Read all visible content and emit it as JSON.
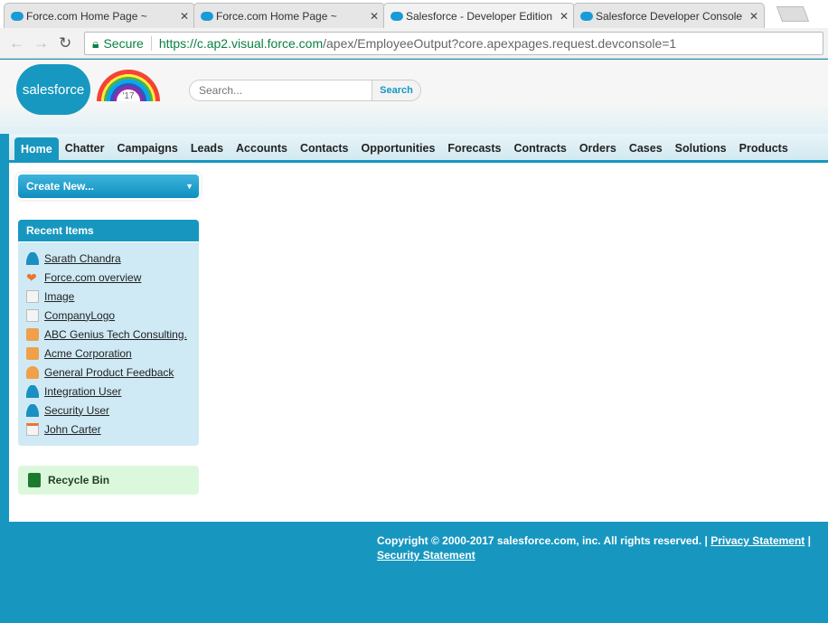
{
  "browser": {
    "tabs": [
      {
        "title": "Force.com Home Page ~"
      },
      {
        "title": "Force.com Home Page ~"
      },
      {
        "title": "Salesforce - Developer Edition"
      },
      {
        "title": "Salesforce Developer Console"
      }
    ],
    "secure_label": "Secure",
    "url_host": "https://c.ap2.visual.force.com",
    "url_path": "/apex/EmployeeOutput?core.apexpages.request.devconsole=1"
  },
  "header": {
    "logo": "salesforce",
    "badge": "'17",
    "search_placeholder": "Search...",
    "search_button": "Search"
  },
  "nav": {
    "tabs": [
      "Home",
      "Chatter",
      "Campaigns",
      "Leads",
      "Accounts",
      "Contacts",
      "Opportunities",
      "Forecasts",
      "Contracts",
      "Orders",
      "Cases",
      "Solutions",
      "Products"
    ]
  },
  "sidebar": {
    "create_new": "Create New...",
    "recent_title": "Recent Items",
    "recent": [
      {
        "label": "Sarath Chandra",
        "icon": "user"
      },
      {
        "label": "Force.com overview",
        "icon": "heart"
      },
      {
        "label": "Image",
        "icon": "doc"
      },
      {
        "label": "CompanyLogo",
        "icon": "doc"
      },
      {
        "label": "ABC Genius Tech Consulting.",
        "icon": "acct"
      },
      {
        "label": "Acme Corporation",
        "icon": "acct"
      },
      {
        "label": "General Product Feedback",
        "icon": "group"
      },
      {
        "label": "Integration User",
        "icon": "user"
      },
      {
        "label": "Security User",
        "icon": "user"
      },
      {
        "label": "John Carter",
        "icon": "contact"
      }
    ],
    "recycle_bin": "Recycle Bin"
  },
  "footer": {
    "copyright": "Copyright © 2000-2017 salesforce.com, inc. All rights reserved. |",
    "privacy": "Privacy Statement",
    "sep": "|",
    "security": "Security Statement"
  }
}
